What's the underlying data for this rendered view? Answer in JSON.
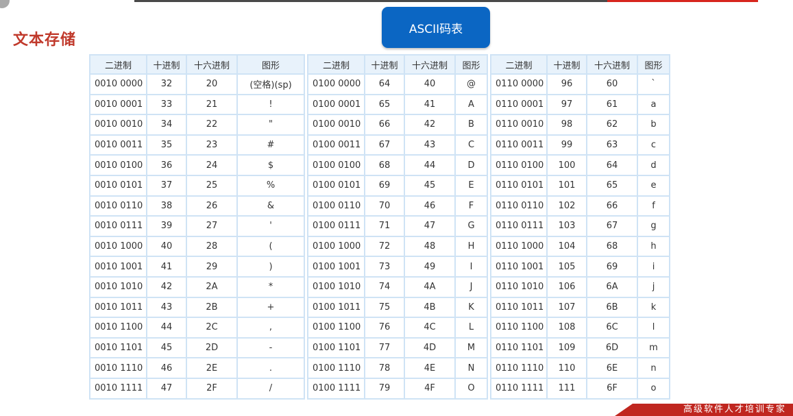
{
  "section_title": "文本存储",
  "banner": "ASCII码表",
  "headers": [
    "二进制",
    "十进制",
    "十六进制",
    "图形"
  ],
  "tables": [
    {
      "rows": [
        [
          "0010 0000",
          "32",
          "20",
          "(空格)(sp)"
        ],
        [
          "0010 0001",
          "33",
          "21",
          "!"
        ],
        [
          "0010 0010",
          "34",
          "22",
          "\""
        ],
        [
          "0010 0011",
          "35",
          "23",
          "#"
        ],
        [
          "0010 0100",
          "36",
          "24",
          "$"
        ],
        [
          "0010 0101",
          "37",
          "25",
          "%"
        ],
        [
          "0010 0110",
          "38",
          "26",
          "&"
        ],
        [
          "0010 0111",
          "39",
          "27",
          "'"
        ],
        [
          "0010 1000",
          "40",
          "28",
          "("
        ],
        [
          "0010 1001",
          "41",
          "29",
          ")"
        ],
        [
          "0010 1010",
          "42",
          "2A",
          "*"
        ],
        [
          "0010 1011",
          "43",
          "2B",
          "+"
        ],
        [
          "0010 1100",
          "44",
          "2C",
          ","
        ],
        [
          "0010 1101",
          "45",
          "2D",
          "-"
        ],
        [
          "0010 1110",
          "46",
          "2E",
          "."
        ],
        [
          "0010 1111",
          "47",
          "2F",
          "/"
        ]
      ]
    },
    {
      "rows": [
        [
          "0100 0000",
          "64",
          "40",
          "@"
        ],
        [
          "0100 0001",
          "65",
          "41",
          "A"
        ],
        [
          "0100 0010",
          "66",
          "42",
          "B"
        ],
        [
          "0100 0011",
          "67",
          "43",
          "C"
        ],
        [
          "0100 0100",
          "68",
          "44",
          "D"
        ],
        [
          "0100 0101",
          "69",
          "45",
          "E"
        ],
        [
          "0100 0110",
          "70",
          "46",
          "F"
        ],
        [
          "0100 0111",
          "71",
          "47",
          "G"
        ],
        [
          "0100 1000",
          "72",
          "48",
          "H"
        ],
        [
          "0100 1001",
          "73",
          "49",
          "I"
        ],
        [
          "0100 1010",
          "74",
          "4A",
          "J"
        ],
        [
          "0100 1011",
          "75",
          "4B",
          "K"
        ],
        [
          "0100 1100",
          "76",
          "4C",
          "L"
        ],
        [
          "0100 1101",
          "77",
          "4D",
          "M"
        ],
        [
          "0100 1110",
          "78",
          "4E",
          "N"
        ],
        [
          "0100 1111",
          "79",
          "4F",
          "O"
        ]
      ]
    },
    {
      "rows": [
        [
          "0110 0000",
          "96",
          "60",
          "`"
        ],
        [
          "0110 0001",
          "97",
          "61",
          "a"
        ],
        [
          "0110 0010",
          "98",
          "62",
          "b"
        ],
        [
          "0110 0011",
          "99",
          "63",
          "c"
        ],
        [
          "0110 0100",
          "100",
          "64",
          "d"
        ],
        [
          "0110 0101",
          "101",
          "65",
          "e"
        ],
        [
          "0110 0110",
          "102",
          "66",
          "f"
        ],
        [
          "0110 0111",
          "103",
          "67",
          "g"
        ],
        [
          "0110 1000",
          "104",
          "68",
          "h"
        ],
        [
          "0110 1001",
          "105",
          "69",
          "i"
        ],
        [
          "0110 1010",
          "106",
          "6A",
          "j"
        ],
        [
          "0110 1011",
          "107",
          "6B",
          "k"
        ],
        [
          "0110 1100",
          "108",
          "6C",
          "l"
        ],
        [
          "0110 1101",
          "109",
          "6D",
          "m"
        ],
        [
          "0110 1110",
          "110",
          "6E",
          "n"
        ],
        [
          "0110 1111",
          "111",
          "6F",
          "o"
        ]
      ]
    }
  ],
  "footer_slogan": "高级软件人才培训专家"
}
